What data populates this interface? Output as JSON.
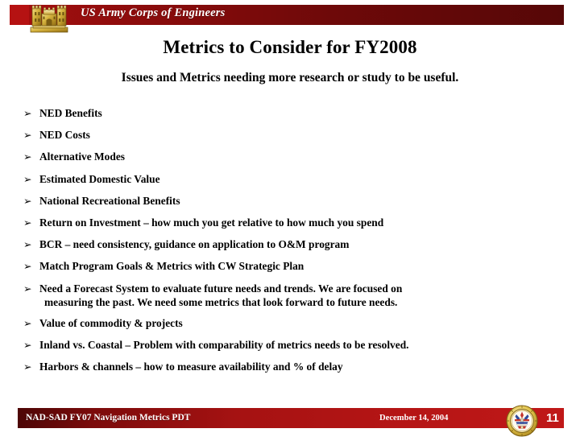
{
  "header": {
    "organization": "US Army Corps of Engineers",
    "logo_icon": "usace-castle-icon",
    "bar_color_left": "#a50f0f",
    "bar_color_right": "#560707",
    "accent_block_color": "#b51212"
  },
  "slide": {
    "title": "Metrics to Consider for FY2008",
    "subtitle": "Issues and Metrics needing more research or study to be useful.",
    "bullet_marker": "➢",
    "bullets": [
      {
        "text": "NED Benefits"
      },
      {
        "text": "NED Costs"
      },
      {
        "text": "Alternative Modes"
      },
      {
        "text": "Estimated Domestic Value"
      },
      {
        "text": "National Recreational Benefits"
      },
      {
        "text": "Return on Investment – how much you get relative to how much you spend"
      },
      {
        "text": "BCR – need consistency, guidance on application to O&M program"
      },
      {
        "text": "Match Program Goals & Metrics with CW Strategic Plan"
      },
      {
        "text": "Need a Forecast System to evaluate future needs and trends.  We are focused on",
        "continuation": "measuring the past.  We need some metrics that look forward to future needs."
      },
      {
        "text": "Value of commodity & projects"
      },
      {
        "text": "Inland vs. Coastal – Problem with comparability of metrics needs to be resolved."
      },
      {
        "text": "Harbors & channels – how to measure availability and % of delay"
      }
    ]
  },
  "footer": {
    "left_text": "NAD-SAD FY07 Navigation Metrics PDT",
    "date": "December 14, 2004",
    "page_number": "11",
    "seal_icon": "department-of-army-seal-icon",
    "bar_color_left": "#4d0606",
    "bar_color_right": "#c01818"
  }
}
